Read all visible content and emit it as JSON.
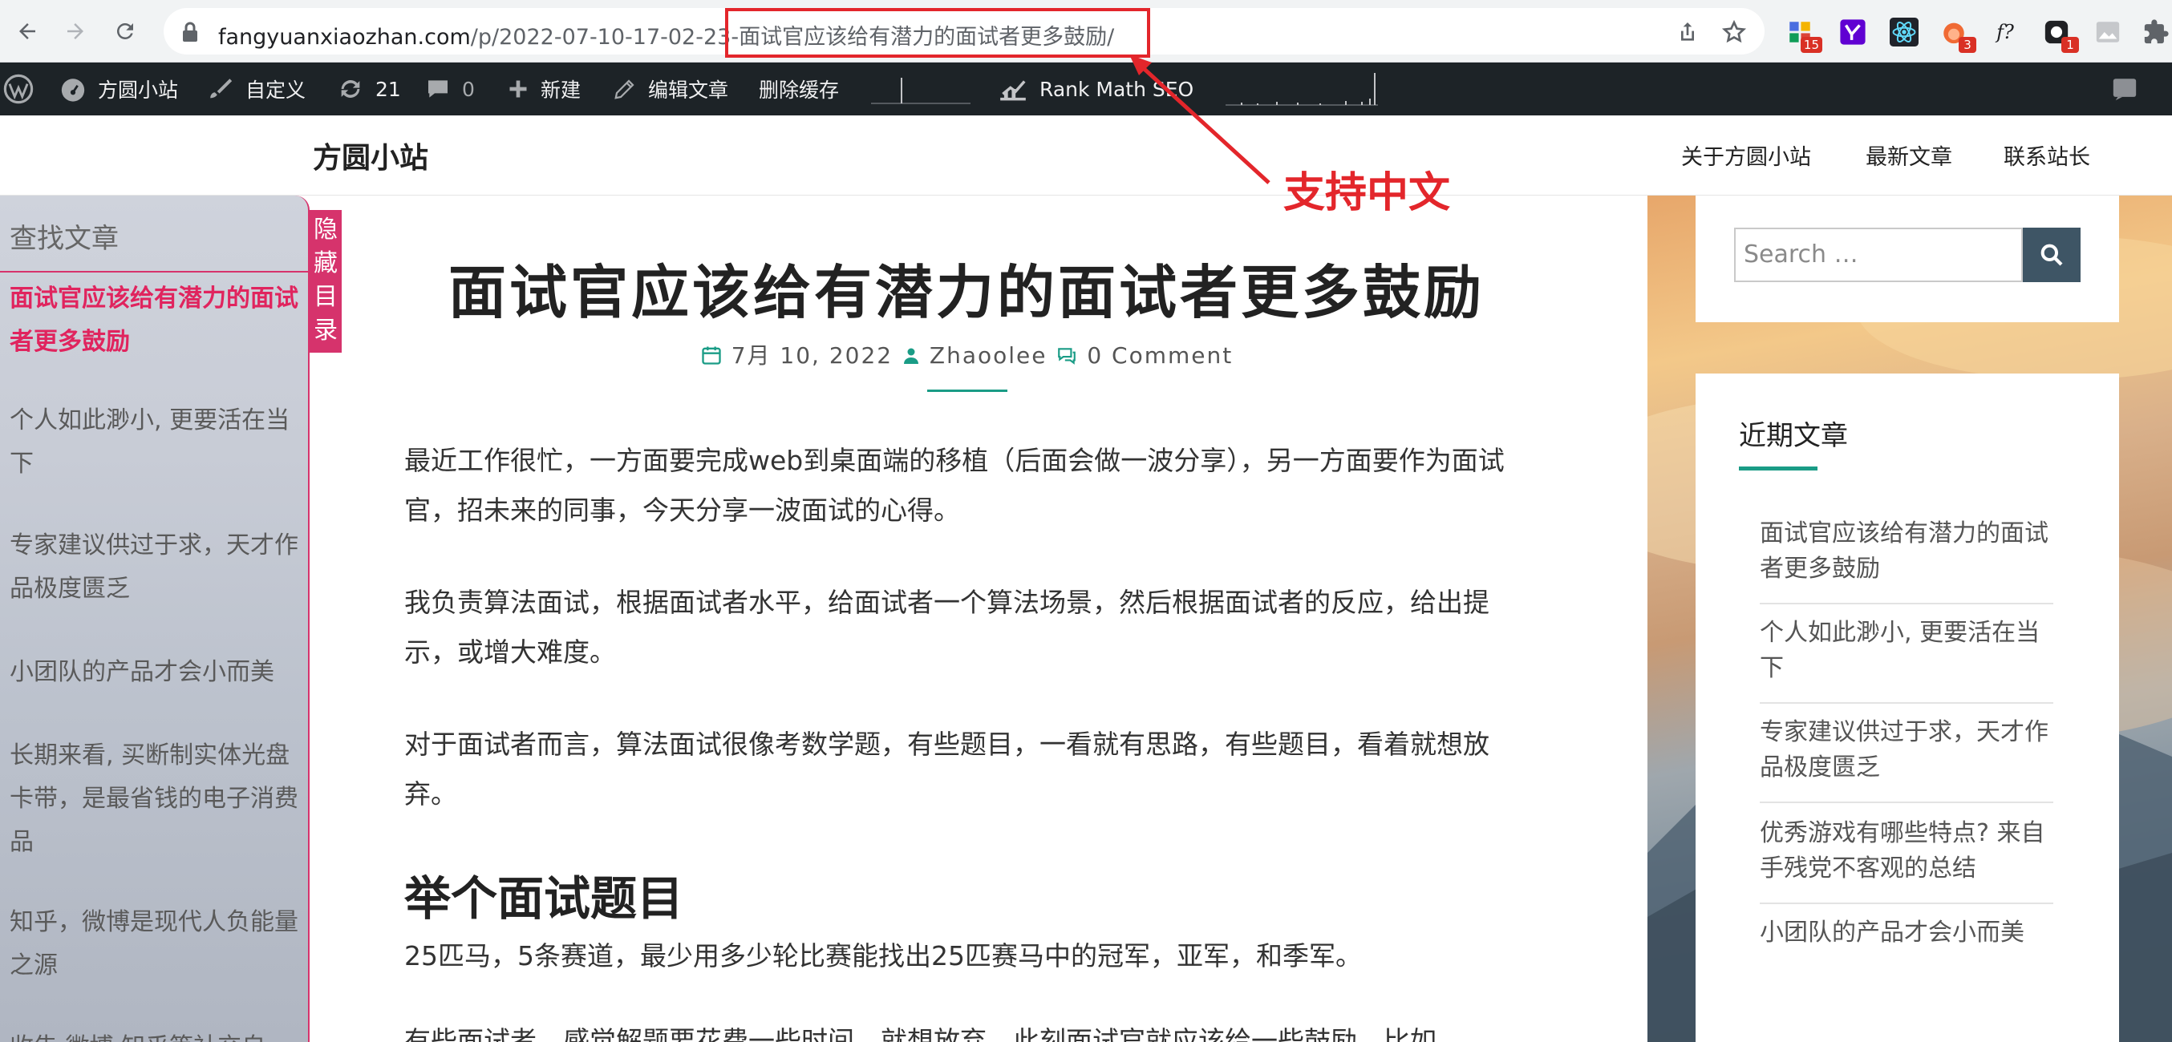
{
  "browser": {
    "url_host": "fangyuanxiaozhan.com",
    "url_path": "/p/2022-07-10-17-02-23-面试官应该给有潜力的面试者更多鼓励/",
    "extensions": [
      {
        "name": "puzzle-extension",
        "badge": "15",
        "color": "#4a6ee0"
      },
      {
        "name": "yahoo-extension",
        "badge": "",
        "color": "#6001d2"
      },
      {
        "name": "react-extension",
        "badge": "",
        "color": "#00b8d9"
      },
      {
        "name": "fire-extension",
        "badge": "3",
        "color": "#f06a34"
      },
      {
        "name": "formula-extension",
        "badge": "",
        "color": "#202124"
      },
      {
        "name": "dark-extension",
        "badge": "1",
        "color": "#202124"
      },
      {
        "name": "image-extension",
        "badge": "",
        "color": "#9aa0a6"
      }
    ],
    "formula_glyph": "f?"
  },
  "adminbar": {
    "site_name": "方圆小站",
    "customize": "自定义",
    "updates": "21",
    "comments": "0",
    "new": "新建",
    "edit_post": "编辑文章",
    "clear_cache": "删除缓存",
    "seo": "Rank Math SEO"
  },
  "header": {
    "site_title": "方圆小站",
    "nav": [
      "关于方圆小站",
      "最新文章",
      "联系站长"
    ]
  },
  "toc": {
    "title": "查找文章",
    "toggle_label": "隐藏目录",
    "items": [
      "面试官应该给有潜力的面试者更多鼓励",
      "个人如此渺小, 更要活在当下",
      "专家建议供过于求，天才作品极度匮乏",
      "小团队的产品才会小而美",
      "长期来看, 买断制实体光盘卡带，是最省钱的电子消费品",
      "知乎，微博是现代人负能量之源",
      "收告 微博 知乎等社交自"
    ]
  },
  "article": {
    "title": "面试官应该给有潜力的面试者更多鼓励",
    "date": "7月 10, 2022",
    "author": "Zhaoolee",
    "comments": "0 Comment",
    "paragraphs": [
      "最近工作很忙，一方面要完成web到桌面端的移植（后面会做一波分享），另一方面要作为面试官，招未来的同事，今天分享一波面试的心得。",
      "我负责算法面试，根据面试者水平，给面试者一个算法场景，然后根据面试者的反应，给出提示，或增大难度。",
      "对于面试者而言，算法面试很像考数学题，有些题目，一看就有思路，有些题目，看着就想放弃。"
    ],
    "h2": "举个面试题目",
    "question": "25匹马，5条赛道，最少用多少轮比赛能找出25匹赛马中的冠军，亚军，和季军。",
    "cutoff": "有些面试者，感觉解题要花费一些时间，就想放弃，此刻面试官就应该给一些鼓励，比如"
  },
  "sidebar": {
    "search_placeholder": "Search …",
    "recent_title": "近期文章",
    "recent_items": [
      "面试官应该给有潜力的面试者更多鼓励",
      "个人如此渺小, 更要活在当下",
      "专家建议供过于求，天才作品极度匮乏",
      "优秀游戏有哪些特点? 来自手残党不客观的总结",
      "小团队的产品才会小而美"
    ]
  },
  "annotation": {
    "text": "支持中文",
    "color": "#e3262b"
  },
  "colors": {
    "accent": "#1a9c86",
    "toc_accent": "#d6336c",
    "adminbar_bg": "#1d2327"
  }
}
